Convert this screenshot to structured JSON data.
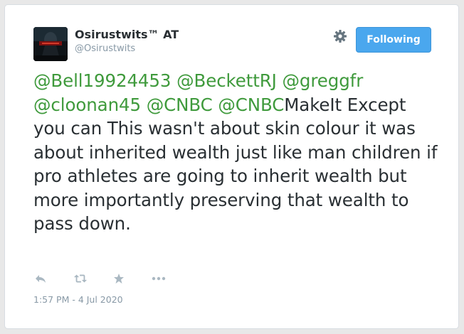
{
  "user": {
    "display_name": "Osirustwits™ AT",
    "handle": "@Osirustwits"
  },
  "header": {
    "follow_label": "Following"
  },
  "tweet": {
    "mentions": [
      "@Bell19924453",
      "@BeckettRJ",
      "@greggfr",
      "@cloonan45",
      "@CNBC",
      "@CNBC"
    ],
    "text_after_mentions": "MakeIt Except you can This wasn't about skin colour it was about inherited wealth just like man children if pro athletes are going to inherit wealth but more importantly preserving that wealth to pass down.",
    "timestamp": "1:57 PM - 4 Jul 2020"
  },
  "colors": {
    "mention": "#3f9a3c",
    "follow_button": "#4aa7ee",
    "text": "#292f33",
    "muted": "#8899a6"
  },
  "icons": [
    "gear-icon",
    "reply-icon",
    "retweet-icon",
    "favorite-icon",
    "more-icon"
  ]
}
